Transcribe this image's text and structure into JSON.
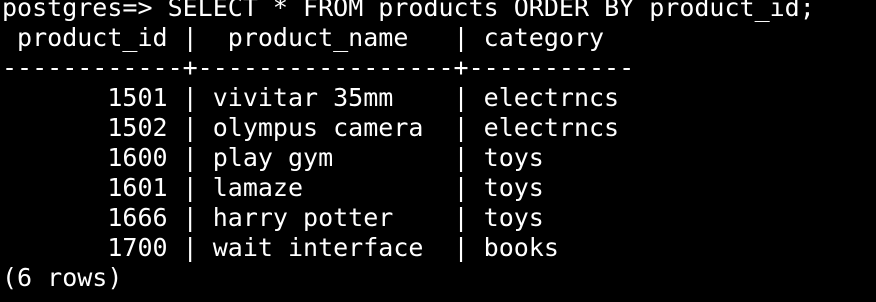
{
  "terminal": {
    "prompt": "postgres=>",
    "command": "SELECT * FROM products ORDER BY product_id;",
    "header": " product_id |  product_name   | category",
    "separator": "------------+-----------------+-----------",
    "rows": [
      "       1501 | vivitar 35mm    | electrncs",
      "       1502 | olympus camera  | electrncs",
      "       1600 | play gym        | toys",
      "       1601 | lamaze          | toys",
      "       1666 | harry potter    | toys",
      "       1700 | wait interface  | books"
    ],
    "footer": "(6 rows)"
  },
  "colors": {
    "background": "#000000",
    "text": "#ffffff"
  }
}
